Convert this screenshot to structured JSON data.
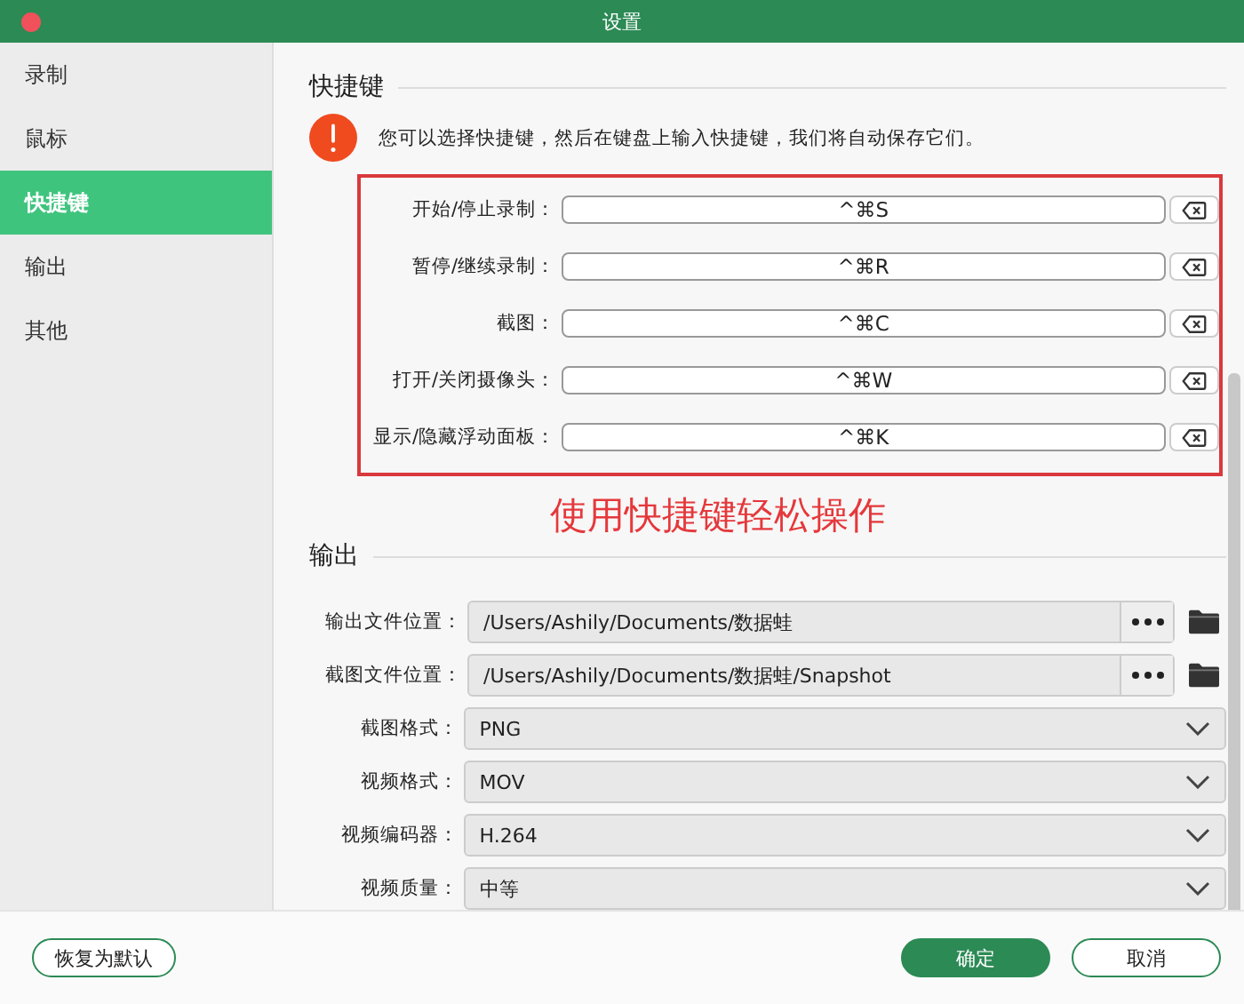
{
  "window": {
    "title": "设置"
  },
  "sidebar": {
    "items": [
      {
        "label": "录制",
        "selected": false
      },
      {
        "label": "鼠标",
        "selected": false
      },
      {
        "label": "快捷键",
        "selected": true
      },
      {
        "label": "输出",
        "selected": false
      },
      {
        "label": "其他",
        "selected": false
      }
    ]
  },
  "shortcuts": {
    "title": "快捷键",
    "notice": "您可以选择快捷键，然后在键盘上输入快捷键，我们将自动保存它们。",
    "rows": [
      {
        "label": "开始/停止录制：",
        "value": "^⌘S"
      },
      {
        "label": "暂停/继续录制：",
        "value": "^⌘R"
      },
      {
        "label": "截图：",
        "value": "^⌘C"
      },
      {
        "label": "打开/关闭摄像头：",
        "value": "^⌘W"
      },
      {
        "label": "显示/隐藏浮动面板：",
        "value": "^⌘K"
      }
    ]
  },
  "annotation": "使用快捷键轻松操作",
  "output": {
    "title": "输出",
    "rows": [
      {
        "kind": "path",
        "label": "输出文件位置：",
        "value": "/Users/Ashily/Documents/数据蛙"
      },
      {
        "kind": "path",
        "label": "截图文件位置：",
        "value": "/Users/Ashily/Documents/数据蛙/Snapshot"
      },
      {
        "kind": "select",
        "label": "截图格式：",
        "value": "PNG"
      },
      {
        "kind": "select",
        "label": "视频格式：",
        "value": "MOV"
      },
      {
        "kind": "select",
        "label": "视频编码器：",
        "value": "H.264"
      },
      {
        "kind": "select",
        "label": "视频质量：",
        "value": "中等"
      }
    ]
  },
  "footer": {
    "reset": "恢复为默认",
    "ok": "确定",
    "cancel": "取消"
  }
}
